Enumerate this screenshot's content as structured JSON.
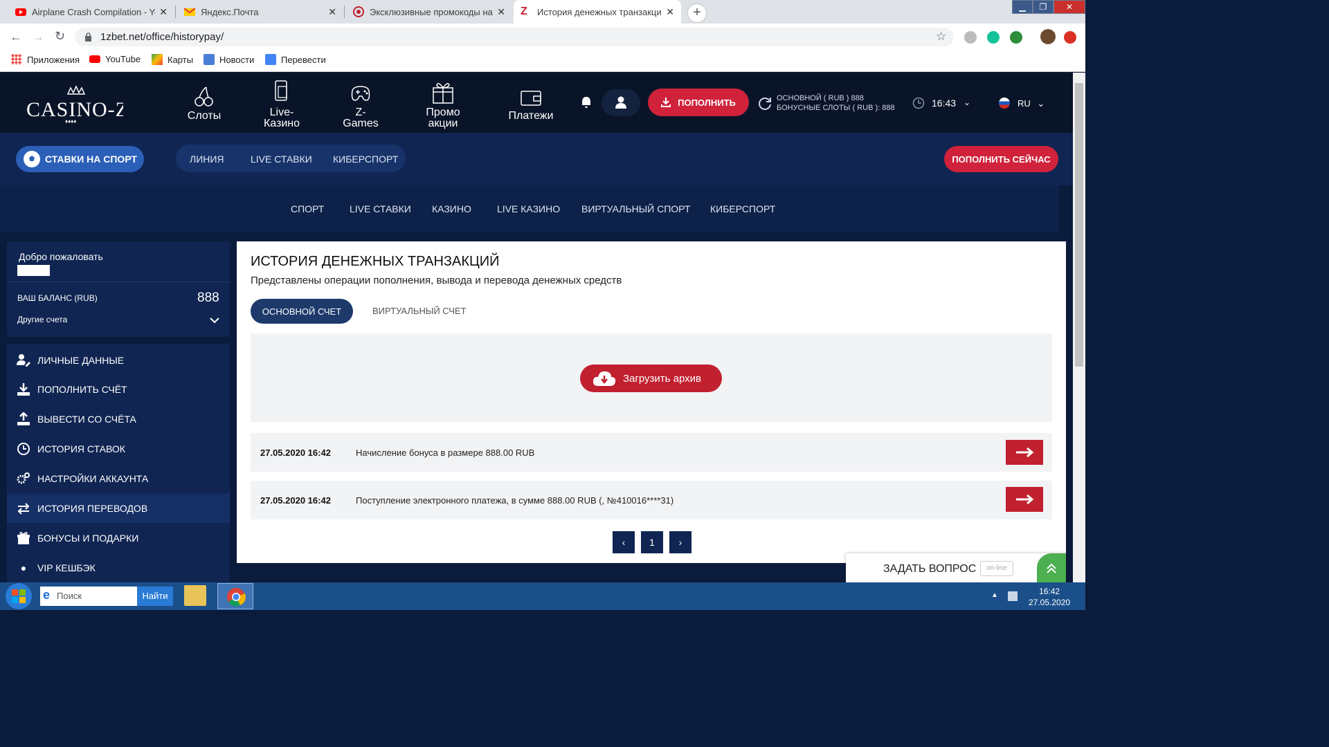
{
  "browser": {
    "tabs": [
      {
        "title": "Airplane Crash Compilation - Yo",
        "icon": "youtube-icon"
      },
      {
        "title": "Яндекс.Почта",
        "icon": "yandex-mail-icon"
      },
      {
        "title": "Эксклюзивные промокоды на с",
        "icon": "promo-icon"
      },
      {
        "title": "История денежных транзакций",
        "icon": "casino-z-icon"
      }
    ],
    "url": "1zbet.net/office/historypay/",
    "bookmarks": [
      "Приложения",
      "YouTube",
      "Карты",
      "Новости",
      "Перевести"
    ]
  },
  "site": {
    "logo": "CASINO-Z",
    "nav": [
      {
        "label": "Слоты"
      },
      {
        "label": "Live-\nКазино"
      },
      {
        "label": "Z-\nGames"
      },
      {
        "label": "Промо\nакции"
      },
      {
        "label": "Платежи"
      }
    ],
    "deposit_label": "ПОПОЛНИТЬ",
    "balance_main": "ОСНОВНОЙ ( RUB ) 888",
    "balance_bonus": "БОНУСНЫЕ СЛОТЫ ( RUB ): 888",
    "time": "16:43",
    "lang": "RU",
    "sport_label": "СТАВКИ НА СПОРТ",
    "pill": [
      "ЛИНИЯ",
      "LIVE СТАВКИ",
      "КИБЕРСПОРТ"
    ],
    "deposit_now": "ПОПОЛНИТЬ СЕЙЧАС",
    "menu2": [
      "СПОРТ",
      "LIVE СТАВКИ",
      "КАЗИНО",
      "LIVE КАЗИНО",
      "ВИРТУАЛЬНЫЙ СПОРТ",
      "КИБЕРСПОРТ"
    ]
  },
  "sidebar": {
    "welcome": "Добро пожаловать",
    "balance_label": "ВАШ БАЛАНС (RUB)",
    "balance_value": "888",
    "other_accounts": "Другие счета",
    "items": [
      "ЛИЧНЫЕ ДАННЫЕ",
      "ПОПОЛНИТЬ СЧЁТ",
      "ВЫВЕСТИ СО СЧЁТА",
      "ИСТОРИЯ СТАВОК",
      "НАСТРОЙКИ АККАУНТА",
      "ИСТОРИЯ ПЕРЕВОДОВ",
      "БОНУСЫ И ПОДАРКИ",
      "VIP КЕШБЭК"
    ]
  },
  "main": {
    "title": "ИСТОРИЯ ДЕНЕЖНЫХ ТРАНЗАКЦИЙ",
    "subtitle": "Представлены операции пополнения, вывода и перевода денежных средств",
    "tab_main": "ОСНОВНОЙ СЧЕТ",
    "tab_virtual": "ВИРТУАЛЬНЫЙ СЧЕТ",
    "archive_btn": "Загрузить архив",
    "transactions": [
      {
        "date": "27.05.2020 16:42",
        "desc": "Начисление бонуса в размере 888.00 RUB"
      },
      {
        "date": "27.05.2020 16:42",
        "desc": "Поступление электронного платежа, в сумме 888.00 RUB (, №410016****31)"
      }
    ],
    "pagination": {
      "prev": "‹",
      "page": "1",
      "next": "›"
    },
    "ask": "ЗАДАТЬ ВОПРОС",
    "online": "on-line"
  },
  "taskbar": {
    "search": "Поиск",
    "find": "Найти",
    "time": "16:42",
    "date": "27.05.2020"
  },
  "colors": {
    "accent": "#d0223b",
    "navy": "#102552",
    "header": "#0a1428"
  }
}
